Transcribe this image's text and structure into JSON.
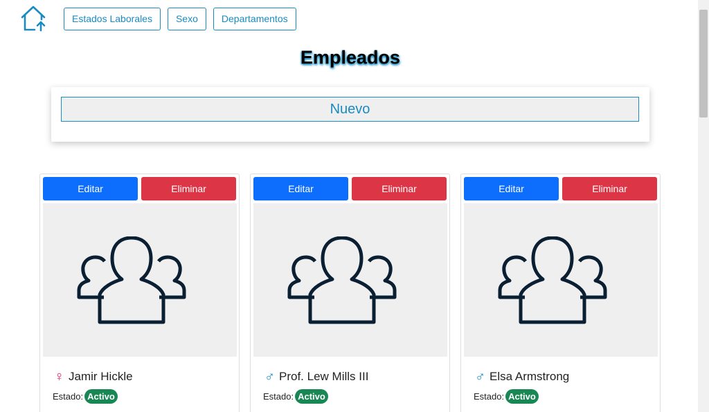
{
  "nav": {
    "items": [
      {
        "label": "Estados Laborales"
      },
      {
        "label": "Sexo"
      },
      {
        "label": "Departamentos"
      }
    ]
  },
  "page_title": "Empleados",
  "new_button": "Nuevo",
  "cards": [
    {
      "edit": "Editar",
      "delete": "Eliminar",
      "gender_icon": "female-icon",
      "gender_symbol": "♀",
      "name": "Jamir Hickle",
      "status_label": "Estado:",
      "status": "Activo"
    },
    {
      "edit": "Editar",
      "delete": "Eliminar",
      "gender_icon": "male-icon",
      "gender_symbol": "♂",
      "name": "Prof. Lew Mills III",
      "status_label": "Estado:",
      "status": "Activo"
    },
    {
      "edit": "Editar",
      "delete": "Eliminar",
      "gender_icon": "male-icon",
      "gender_symbol": "♂",
      "name": "Elsa Armstrong",
      "status_label": "Estado:",
      "status": "Activo"
    }
  ],
  "colors": {
    "accent": "#1a8bc0",
    "edit": "#0d6efd",
    "delete": "#dc3545",
    "status_active": "#198754",
    "female": "#e91e63"
  }
}
